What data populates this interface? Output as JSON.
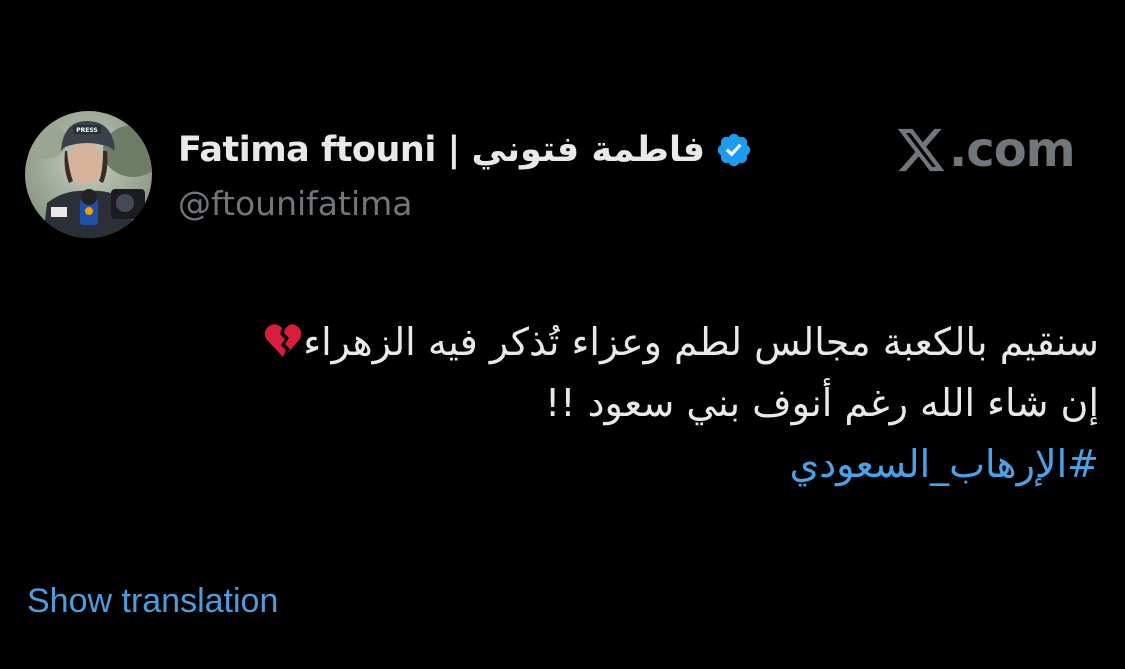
{
  "author": {
    "display_name": "Fatima ftouni | فاطمة فتوني",
    "handle": "@ftounifatima",
    "verified": true,
    "avatar_press_label": "PRESS"
  },
  "brand": {
    "icon": "x-logo-icon",
    "text": ".com"
  },
  "tweet": {
    "line_1": "سنقيم بالكعبة مجالس لطم وعزاء تُذكر فيه الزهراء",
    "line_1_emoji": "broken-heart-icon",
    "line_2": "إن شاء الله رغم أنوف بني سعود !!",
    "hashtag": "#الإرهاب_السعودي"
  },
  "actions": {
    "show_translation": "Show translation"
  },
  "colors": {
    "background": "#000000",
    "text_primary": "#e7e9ea",
    "text_secondary": "#71767b",
    "link": "#4a9ee0",
    "verified_badge": "#1d9bf0",
    "broken_heart": "#d81e3a"
  }
}
